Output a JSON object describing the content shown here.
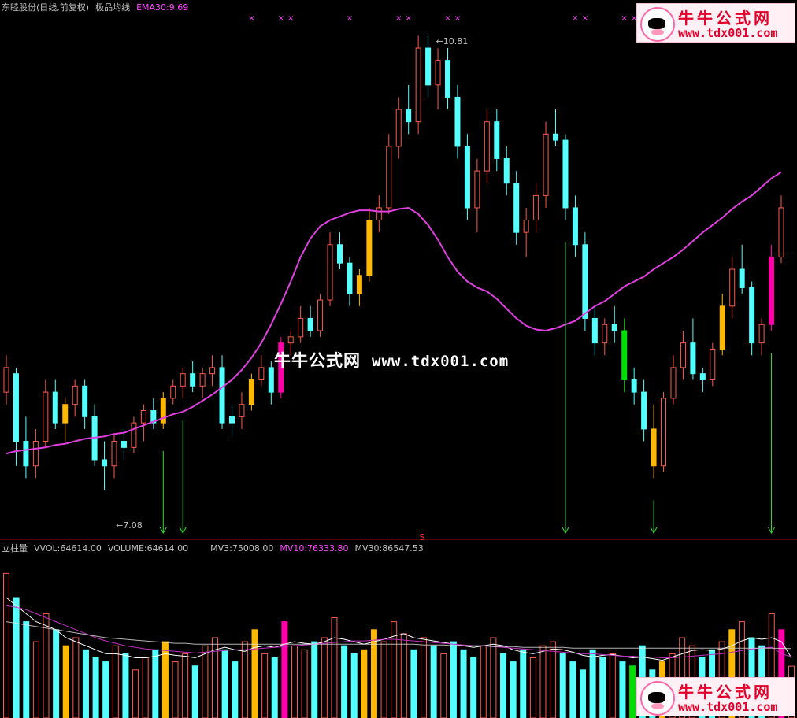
{
  "price_header": {
    "stock": "东睦股份(日线,前复权)",
    "indicator": "极品均线",
    "ema_label": "EMA30:9.69"
  },
  "volume_header": {
    "name": "立柱量",
    "vvol": "VVOL:64614.00",
    "volume": "VOLUME:64614.00",
    "mv3": "MV3:75008.00",
    "mv10": "MV10:76333.80",
    "mv30": "MV30:86547.53"
  },
  "watermark": {
    "cn": "牛牛公式网",
    "url": "www.tdx001.com"
  },
  "logo": {
    "cn": "牛牛公式网",
    "url": "www.tdx001.com"
  },
  "annotations": {
    "high": "10.81",
    "low": "7.08",
    "marker": "S"
  },
  "colors": {
    "bg": "#000000",
    "up": "#ff5a4a",
    "down": "#54ffff",
    "strong_up": "#ffb800",
    "signal_up": "#ff00aa",
    "signal_down": "#00dd00",
    "ema": "#e040e0",
    "arrow": "#33dd33",
    "cross": "#ff44ff",
    "mv_white": "#ffffff",
    "mv_magenta": "#c030c0",
    "mv_yellow": "#ffff66"
  },
  "chart_data": [
    {
      "type": "candlestick",
      "title": "东睦股份(日线,前复权) 极品均线",
      "ylim": [
        6.85,
        10.95
      ],
      "ema30": 9.69,
      "series": [
        {
          "name": "EMA30",
          "values": [
            7.4,
            7.42,
            7.43,
            7.44,
            7.45,
            7.47,
            7.48,
            7.5,
            7.52,
            7.53,
            7.54,
            7.56,
            7.57,
            7.6,
            7.63,
            7.66,
            7.69,
            7.72,
            7.74,
            7.78,
            7.83,
            7.88,
            7.94,
            8.0,
            8.08,
            8.18,
            8.3,
            8.45,
            8.62,
            8.8,
            9.0,
            9.15,
            9.25,
            9.3,
            9.33,
            9.36,
            9.38,
            9.38,
            9.37,
            9.37,
            9.39,
            9.4,
            9.35,
            9.26,
            9.14,
            9.0,
            8.88,
            8.8,
            8.75,
            8.72,
            8.66,
            8.58,
            8.5,
            8.44,
            8.41,
            8.4,
            8.42,
            8.45,
            8.48,
            8.54,
            8.6,
            8.64,
            8.7,
            8.76,
            8.8,
            8.84,
            8.9,
            8.95,
            9.0,
            9.06,
            9.13,
            9.2,
            9.26,
            9.32,
            9.39,
            9.45,
            9.5,
            9.57,
            9.64,
            9.69
          ]
        }
      ],
      "candles": [
        [
          7.9,
          8.2,
          7.8,
          8.1,
          "u"
        ],
        [
          8.05,
          8.1,
          7.3,
          7.5,
          "d"
        ],
        [
          7.5,
          7.7,
          7.2,
          7.3,
          "d"
        ],
        [
          7.3,
          7.6,
          7.2,
          7.5,
          "u"
        ],
        [
          7.5,
          8.0,
          7.45,
          7.9,
          "u"
        ],
        [
          7.9,
          8.0,
          7.6,
          7.65,
          "d"
        ],
        [
          7.65,
          7.85,
          7.5,
          7.8,
          "s"
        ],
        [
          7.8,
          8.0,
          7.7,
          7.95,
          "u"
        ],
        [
          7.95,
          8.0,
          7.6,
          7.7,
          "d"
        ],
        [
          7.7,
          7.8,
          7.3,
          7.35,
          "d"
        ],
        [
          7.35,
          7.5,
          7.1,
          7.3,
          "d"
        ],
        [
          7.3,
          7.55,
          7.2,
          7.5,
          "u"
        ],
        [
          7.5,
          7.6,
          7.35,
          7.45,
          "d"
        ],
        [
          7.45,
          7.7,
          7.4,
          7.65,
          "u"
        ],
        [
          7.65,
          7.8,
          7.5,
          7.75,
          "u"
        ],
        [
          7.75,
          7.85,
          7.6,
          7.65,
          "d"
        ],
        [
          7.65,
          7.9,
          7.6,
          7.85,
          "s"
        ],
        [
          7.85,
          8.0,
          7.8,
          7.95,
          "u"
        ],
        [
          7.95,
          8.1,
          7.85,
          8.05,
          "u"
        ],
        [
          8.05,
          8.15,
          7.9,
          7.95,
          "d"
        ],
        [
          7.95,
          8.1,
          7.85,
          8.05,
          "u"
        ],
        [
          8.05,
          8.2,
          7.95,
          8.1,
          "u"
        ],
        [
          8.1,
          8.2,
          7.6,
          7.65,
          "d"
        ],
        [
          7.65,
          7.8,
          7.55,
          7.7,
          "d"
        ],
        [
          7.7,
          7.9,
          7.6,
          7.8,
          "u"
        ],
        [
          7.8,
          8.05,
          7.75,
          8.0,
          "s"
        ],
        [
          8.0,
          8.2,
          7.95,
          8.1,
          "u"
        ],
        [
          8.1,
          8.15,
          7.8,
          7.9,
          "d"
        ],
        [
          7.9,
          8.35,
          7.85,
          8.3,
          "S"
        ],
        [
          8.3,
          8.4,
          8.2,
          8.35,
          "u"
        ],
        [
          8.35,
          8.6,
          8.3,
          8.5,
          "u"
        ],
        [
          8.5,
          8.6,
          8.35,
          8.4,
          "d"
        ],
        [
          8.4,
          8.7,
          8.35,
          8.65,
          "u"
        ],
        [
          8.65,
          9.2,
          8.6,
          9.1,
          "u"
        ],
        [
          9.1,
          9.2,
          8.9,
          8.95,
          "d"
        ],
        [
          8.95,
          9.0,
          8.6,
          8.7,
          "d"
        ],
        [
          8.7,
          8.9,
          8.6,
          8.85,
          "s"
        ],
        [
          8.85,
          9.4,
          8.8,
          9.3,
          "s"
        ],
        [
          9.3,
          9.5,
          9.2,
          9.4,
          "u"
        ],
        [
          9.4,
          10.0,
          9.35,
          9.9,
          "u"
        ],
        [
          9.9,
          10.3,
          9.8,
          10.2,
          "u"
        ],
        [
          10.2,
          10.4,
          10.0,
          10.1,
          "d"
        ],
        [
          10.1,
          10.8,
          10.0,
          10.7,
          "u"
        ],
        [
          10.7,
          10.81,
          10.3,
          10.4,
          "d"
        ],
        [
          10.4,
          10.7,
          10.2,
          10.6,
          "u"
        ],
        [
          10.6,
          10.7,
          10.2,
          10.3,
          "d"
        ],
        [
          10.3,
          10.4,
          9.8,
          9.9,
          "d"
        ],
        [
          9.9,
          10.0,
          9.3,
          9.4,
          "d"
        ],
        [
          9.4,
          9.8,
          9.2,
          9.7,
          "u"
        ],
        [
          9.7,
          10.2,
          9.6,
          10.1,
          "u"
        ],
        [
          10.1,
          10.2,
          9.7,
          9.8,
          "d"
        ],
        [
          9.8,
          9.9,
          9.5,
          9.6,
          "d"
        ],
        [
          9.6,
          9.7,
          9.1,
          9.2,
          "d"
        ],
        [
          9.2,
          9.4,
          9.0,
          9.3,
          "u"
        ],
        [
          9.3,
          9.6,
          9.2,
          9.5,
          "u"
        ],
        [
          9.5,
          10.1,
          9.4,
          10.0,
          "u"
        ],
        [
          10.0,
          10.2,
          9.9,
          9.95,
          "d"
        ],
        [
          9.95,
          10.0,
          9.3,
          9.4,
          "d"
        ],
        [
          9.4,
          9.5,
          9.0,
          9.1,
          "d"
        ],
        [
          9.1,
          9.2,
          8.4,
          8.5,
          "d"
        ],
        [
          8.5,
          8.6,
          8.2,
          8.3,
          "d"
        ],
        [
          8.3,
          8.5,
          8.2,
          8.45,
          "u"
        ],
        [
          8.45,
          8.6,
          8.3,
          8.4,
          "d"
        ],
        [
          8.4,
          8.5,
          7.9,
          8.0,
          "D"
        ],
        [
          8.0,
          8.1,
          7.8,
          7.9,
          "d"
        ],
        [
          7.9,
          8.0,
          7.5,
          7.6,
          "d"
        ],
        [
          7.6,
          7.8,
          7.2,
          7.3,
          "s"
        ],
        [
          7.3,
          7.9,
          7.25,
          7.85,
          "u"
        ],
        [
          7.85,
          8.2,
          7.8,
          8.1,
          "u"
        ],
        [
          8.1,
          8.4,
          8.0,
          8.3,
          "u"
        ],
        [
          8.3,
          8.5,
          8.0,
          8.05,
          "d"
        ],
        [
          8.05,
          8.1,
          7.9,
          8.0,
          "d"
        ],
        [
          8.0,
          8.3,
          7.95,
          8.25,
          "u"
        ],
        [
          8.25,
          8.7,
          8.2,
          8.6,
          "s"
        ],
        [
          8.6,
          9.0,
          8.5,
          8.9,
          "u"
        ],
        [
          8.9,
          9.1,
          8.7,
          8.75,
          "d"
        ],
        [
          8.75,
          8.8,
          8.2,
          8.3,
          "d"
        ],
        [
          8.3,
          8.5,
          8.2,
          8.45,
          "u"
        ],
        [
          8.45,
          9.1,
          8.4,
          9.0,
          "S"
        ],
        [
          9.0,
          9.5,
          8.95,
          9.4,
          "u"
        ]
      ]
    },
    {
      "type": "bar",
      "title": "立柱量",
      "ylim": [
        0,
        200000
      ],
      "values": [
        180000,
        150000,
        120000,
        95000,
        130000,
        110000,
        90000,
        100000,
        85000,
        75000,
        70000,
        90000,
        80000,
        60000,
        75000,
        85000,
        95000,
        70000,
        80000,
        65000,
        90000,
        100000,
        85000,
        70000,
        95000,
        110000,
        80000,
        75000,
        120000,
        90000,
        85000,
        95000,
        100000,
        125000,
        90000,
        80000,
        85000,
        110000,
        95000,
        120000,
        105000,
        85000,
        100000,
        90000,
        80000,
        95000,
        85000,
        75000,
        90000,
        100000,
        80000,
        70000,
        85000,
        75000,
        90000,
        95000,
        80000,
        70000,
        60000,
        85000,
        75000,
        80000,
        70000,
        65000,
        90000,
        60000,
        70000,
        80000,
        100000,
        90000,
        75000,
        85000,
        95000,
        110000,
        120000,
        100000,
        90000,
        130000,
        110000,
        64614
      ],
      "series": [
        {
          "name": "MV3",
          "values": [
            150000,
            140000,
            130000,
            120000,
            115000,
            110000,
            100000,
            95000,
            90000,
            85000,
            80000,
            80000,
            78000,
            75000,
            75000,
            77000,
            80000,
            78000,
            77000,
            75000,
            80000,
            85000,
            88000,
            85000,
            83000,
            88000,
            90000,
            88000,
            92000,
            95000,
            93000,
            92000,
            95000,
            100000,
            98000,
            95000,
            92000,
            95000,
            98000,
            102000,
            105000,
            100000,
            98000,
            96000,
            94000,
            92000,
            90000,
            88000,
            90000,
            92000,
            90000,
            85000,
            82000,
            80000,
            83000,
            86000,
            85000,
            82000,
            78000,
            76000,
            78000,
            79000,
            77000,
            75000,
            76000,
            74000,
            72000,
            76000,
            80000,
            84000,
            85000,
            84000,
            86000,
            90000,
            96000,
            100000,
            98000,
            100000,
            95000,
            75008
          ]
        },
        {
          "name": "MV10",
          "values": [
            140000,
            138000,
            135000,
            130000,
            125000,
            120000,
            115000,
            110000,
            105000,
            100000,
            96000,
            93000,
            90000,
            88000,
            86000,
            85000,
            84000,
            83000,
            82000,
            81000,
            82000,
            83000,
            84000,
            85000,
            85000,
            86000,
            87000,
            88000,
            89000,
            90000,
            91000,
            92000,
            93000,
            94000,
            95000,
            96000,
            96000,
            97000,
            98000,
            98000,
            97000,
            96000,
            95000,
            94000,
            93000,
            92000,
            91000,
            90000,
            90000,
            89000,
            88000,
            87000,
            86000,
            85000,
            84000,
            83000,
            82000,
            81000,
            80000,
            80000,
            79000,
            78000,
            77000,
            77000,
            76000,
            76000,
            75000,
            75000,
            76000,
            77000,
            78000,
            79000,
            80000,
            82000,
            84000,
            86000,
            87000,
            88000,
            80000,
            76333.8
          ]
        },
        {
          "name": "MV30",
          "values": [
            120000,
            118000,
            116000,
            114000,
            112000,
            110000,
            108000,
            106000,
            104000,
            102000,
            100000,
            99000,
            98000,
            97000,
            96000,
            95000,
            94000,
            93000,
            93000,
            92000,
            92000,
            92000,
            92000,
            92000,
            92000,
            92000,
            92000,
            92000,
            92000,
            92000,
            92000,
            92000,
            92000,
            92000,
            92000,
            92000,
            92000,
            92000,
            92000,
            92000,
            92000,
            92000,
            91000,
            91000,
            91000,
            90000,
            90000,
            90000,
            90000,
            89000,
            89000,
            89000,
            88000,
            88000,
            88000,
            88000,
            88000,
            87000,
            87000,
            87000,
            87000,
            87000,
            87000,
            87000,
            87000,
            87000,
            87000,
            87000,
            87000,
            87000,
            87000,
            87000,
            87000,
            87000,
            87000,
            87000,
            87000,
            87000,
            86800,
            86547.53
          ]
        }
      ]
    }
  ],
  "signals": {
    "down_arrows_at": [
      16,
      18,
      57,
      66,
      78
    ],
    "crosses_at": [
      25,
      28,
      29,
      35,
      40,
      41,
      45,
      46,
      58,
      59,
      63,
      64,
      65,
      67
    ]
  }
}
